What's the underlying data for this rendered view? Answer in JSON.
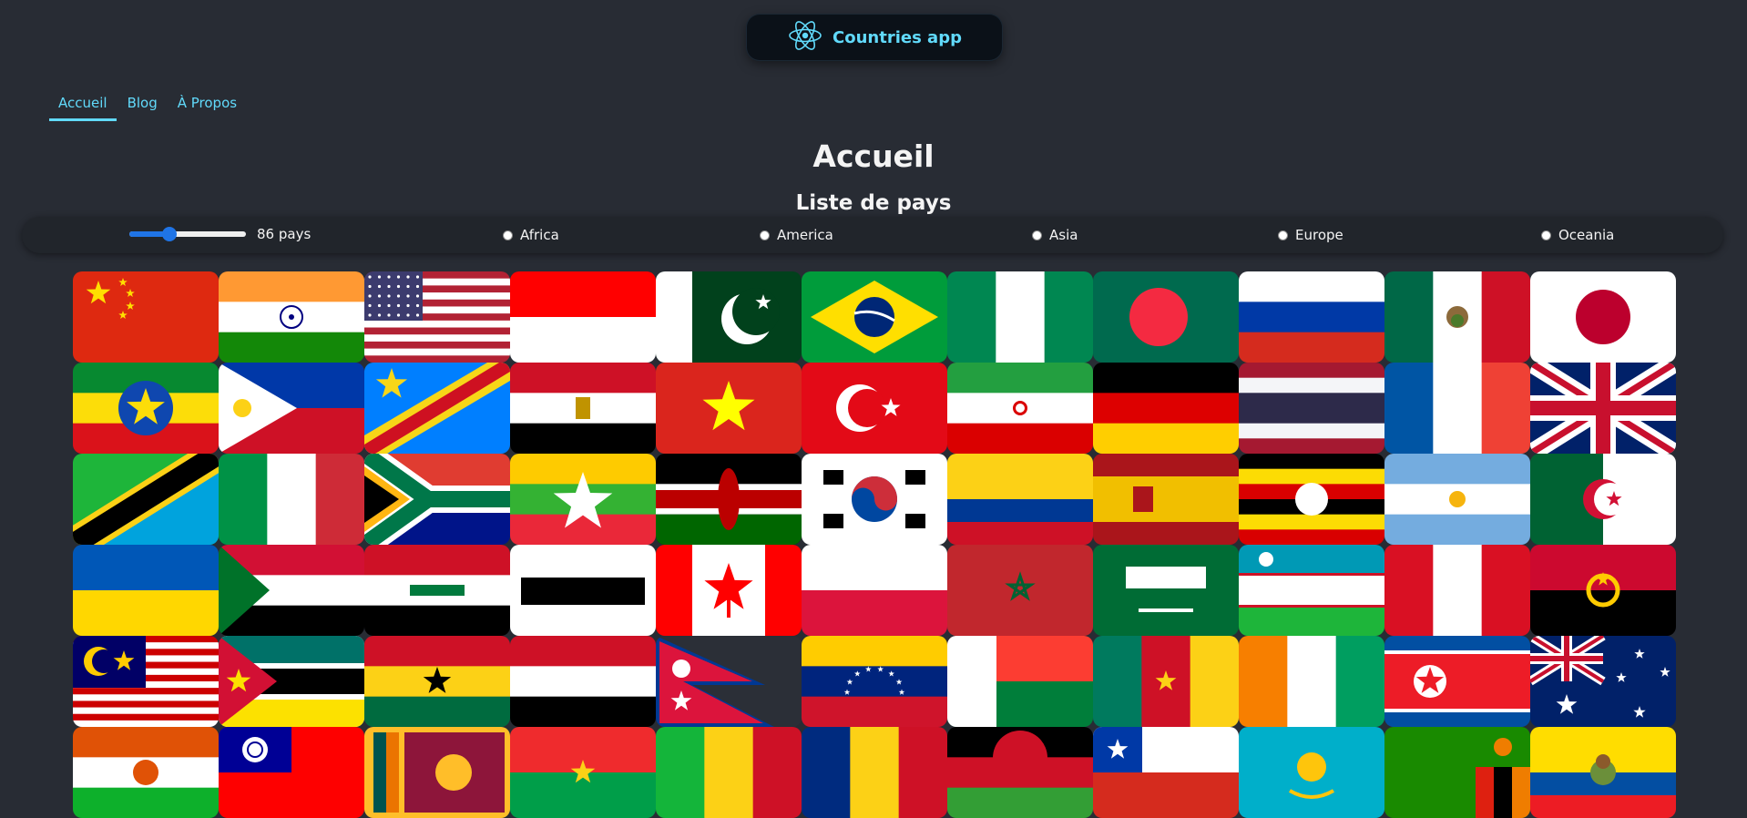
{
  "header": {
    "title": "Countries app",
    "logo_icon": "react-atom-icon"
  },
  "nav": {
    "items": [
      {
        "label": "Accueil",
        "active": true
      },
      {
        "label": "Blog",
        "active": false
      },
      {
        "label": "À Propos",
        "active": false
      }
    ]
  },
  "page": {
    "title": "Accueil",
    "subtitle": "Liste de pays"
  },
  "filters": {
    "range": {
      "value": 86,
      "min": 1,
      "max": 250,
      "label": "86 pays"
    },
    "regions": [
      "Africa",
      "America",
      "Asia",
      "Europe",
      "Oceania"
    ],
    "selected_region": ""
  },
  "colors": {
    "accent": "#61dafb",
    "background": "#282c34",
    "slider": "#1f74e6"
  },
  "flags": [
    "china",
    "india",
    "usa",
    "indonesia",
    "pakistan",
    "brazil",
    "nigeria",
    "bangladesh",
    "russia",
    "mexico",
    "japan",
    "ethiopia",
    "philippines",
    "dr-congo",
    "egypt",
    "vietnam",
    "turkey",
    "iran",
    "germany",
    "thailand",
    "france",
    "united-kingdom",
    "tanzania",
    "italy",
    "south-africa",
    "myanmar",
    "kenya",
    "south-korea",
    "colombia",
    "spain",
    "uganda",
    "argentina",
    "algeria",
    "ukraine",
    "sudan",
    "iraq",
    "afghanistan",
    "canada",
    "poland",
    "morocco",
    "saudi-arabia",
    "uzbekistan",
    "peru",
    "angola",
    "malaysia",
    "mozambique",
    "ghana",
    "yemen",
    "nepal",
    "venezuela",
    "madagascar",
    "cameroon",
    "ivory-coast",
    "north-korea",
    "australia",
    "niger",
    "taiwan",
    "sri-lanka",
    "burkina-faso",
    "mali",
    "romania",
    "malawi",
    "chile",
    "kazakhstan",
    "zambia",
    "ecuador"
  ]
}
